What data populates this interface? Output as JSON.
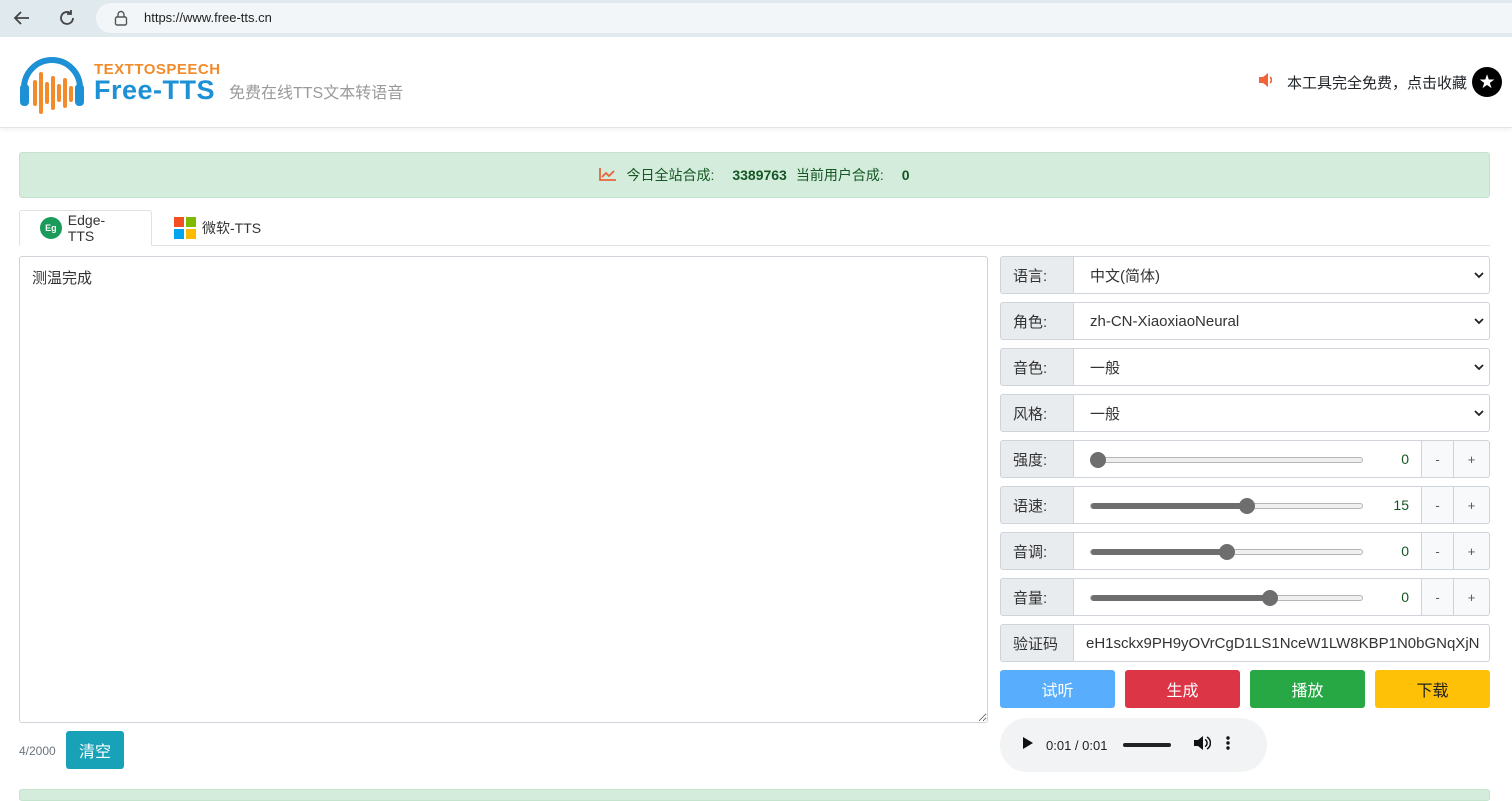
{
  "browser": {
    "url": "https://www.free-tts.cn"
  },
  "header": {
    "logo_top": "TEXTTOSPEECH",
    "logo_main": "Free-TTS",
    "tagline": "免费在线TTS文本转语音",
    "favorite_text": "本工具完全免费，点击收藏"
  },
  "stats": {
    "today_label": "今日全站合成:",
    "today_count": "3389763",
    "user_label": "当前用户合成:",
    "user_count": "0"
  },
  "tabs": [
    {
      "label": "Edge-TTS",
      "icon": "edge-tts-icon",
      "active": true
    },
    {
      "label": "微软-TTS",
      "icon": "microsoft-logo-icon",
      "active": false
    }
  ],
  "editor": {
    "text": "测温完成",
    "counter": "4/2000",
    "clear_label": "清空"
  },
  "settings": {
    "language": {
      "label": "语言:",
      "value": "中文(简体)"
    },
    "voice": {
      "label": "角色:",
      "value": "zh-CN-XiaoxiaoNeural"
    },
    "timbre": {
      "label": "音色:",
      "value": "一般"
    },
    "style": {
      "label": "风格:",
      "value": "一般"
    },
    "intensity": {
      "label": "强度:",
      "value": "0",
      "fraction": 0.03
    },
    "speed": {
      "label": "语速:",
      "value": "15",
      "fraction": 0.575
    },
    "pitch": {
      "label": "音调:",
      "value": "0",
      "fraction": 0.5
    },
    "volume": {
      "label": "音量:",
      "value": "0",
      "fraction": 0.66
    },
    "minus": "-",
    "plus": "+",
    "captcha": {
      "label": "验证码",
      "value": "eH1sckx9PH9yOVrCgD1LS1NceW1LW8KBP1N0bGNqXjN"
    }
  },
  "actions": {
    "preview": "试听",
    "generate": "生成",
    "play": "播放",
    "download": "下载"
  },
  "player": {
    "time": "0:01 / 0:01"
  },
  "colors": {
    "preview": "#58aefc",
    "generate": "#dc3545",
    "play": "#28a745",
    "download": "#ffc107",
    "stats_bg": "#d4ecdc",
    "logo_blue": "#1e90d6",
    "logo_orange": "#f28b2b"
  }
}
